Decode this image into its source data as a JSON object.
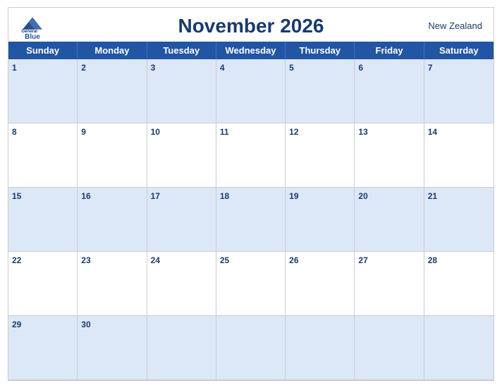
{
  "calendar": {
    "month_title": "November 2026",
    "country": "New Zealand",
    "days_of_week": [
      "Sunday",
      "Monday",
      "Tuesday",
      "Wednesday",
      "Thursday",
      "Friday",
      "Saturday"
    ],
    "weeks": [
      [
        {
          "date": "1",
          "blue": true
        },
        {
          "date": "2",
          "blue": true
        },
        {
          "date": "3",
          "blue": true
        },
        {
          "date": "4",
          "blue": true
        },
        {
          "date": "5",
          "blue": true
        },
        {
          "date": "6",
          "blue": true
        },
        {
          "date": "7",
          "blue": true
        }
      ],
      [
        {
          "date": "8",
          "blue": false
        },
        {
          "date": "9",
          "blue": false
        },
        {
          "date": "10",
          "blue": false
        },
        {
          "date": "11",
          "blue": false
        },
        {
          "date": "12",
          "blue": false
        },
        {
          "date": "13",
          "blue": false
        },
        {
          "date": "14",
          "blue": false
        }
      ],
      [
        {
          "date": "15",
          "blue": true
        },
        {
          "date": "16",
          "blue": true
        },
        {
          "date": "17",
          "blue": true
        },
        {
          "date": "18",
          "blue": true
        },
        {
          "date": "19",
          "blue": true
        },
        {
          "date": "20",
          "blue": true
        },
        {
          "date": "21",
          "blue": true
        }
      ],
      [
        {
          "date": "22",
          "blue": false
        },
        {
          "date": "23",
          "blue": false
        },
        {
          "date": "24",
          "blue": false
        },
        {
          "date": "25",
          "blue": false
        },
        {
          "date": "26",
          "blue": false
        },
        {
          "date": "27",
          "blue": false
        },
        {
          "date": "28",
          "blue": false
        }
      ],
      [
        {
          "date": "29",
          "blue": true
        },
        {
          "date": "30",
          "blue": true
        },
        {
          "date": "",
          "blue": true
        },
        {
          "date": "",
          "blue": true
        },
        {
          "date": "",
          "blue": true
        },
        {
          "date": "",
          "blue": true
        },
        {
          "date": "",
          "blue": true
        }
      ]
    ],
    "logo": {
      "general": "General",
      "blue": "Blue"
    }
  }
}
